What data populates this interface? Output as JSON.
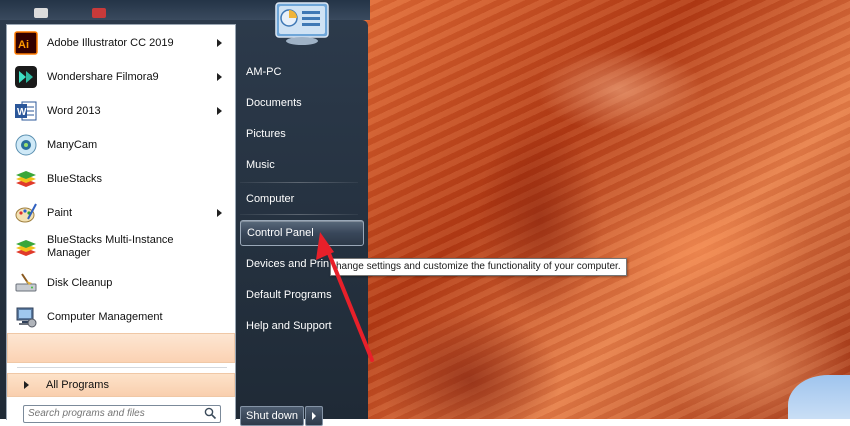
{
  "programs": [
    {
      "label": "Adobe Illustrator CC 2019",
      "icon": "illustrator-icon",
      "has_submenu": true
    },
    {
      "label": "Wondershare Filmora9",
      "icon": "filmora-icon",
      "has_submenu": true
    },
    {
      "label": "Word 2013",
      "icon": "word-icon",
      "has_submenu": true
    },
    {
      "label": "ManyCam",
      "icon": "manycam-icon",
      "has_submenu": false
    },
    {
      "label": "BlueStacks",
      "icon": "bluestacks-icon",
      "has_submenu": false
    },
    {
      "label": "Paint",
      "icon": "paint-icon",
      "has_submenu": true
    },
    {
      "label": "BlueStacks Multi-Instance Manager",
      "label_line1": "BlueStacks Multi-Instance",
      "label_line2": "Manager",
      "icon": "bluestacks-multi-icon",
      "has_submenu": false
    },
    {
      "label": "Disk Cleanup",
      "icon": "disk-cleanup-icon",
      "has_submenu": false
    },
    {
      "label": "Computer Management",
      "icon": "computer-management-icon",
      "has_submenu": false
    }
  ],
  "all_programs": {
    "label": "All Programs"
  },
  "search": {
    "placeholder": "Search programs and files"
  },
  "right_pane": {
    "items": [
      {
        "label": "AM-PC"
      },
      {
        "label": "Documents"
      },
      {
        "label": "Pictures"
      },
      {
        "label": "Music"
      },
      {
        "label": "Computer"
      },
      {
        "label": "Control Panel",
        "selected": true
      },
      {
        "label": "Devices and Printers",
        "visible_label": "Devices and Prin"
      },
      {
        "label": "Default Programs"
      },
      {
        "label": "Help and Support"
      }
    ]
  },
  "shutdown": {
    "label": "Shut down"
  },
  "tooltip": {
    "text": "Change settings and customize the functionality of your computer.",
    "visible_text": "hange settings and customize the functionality of your computer."
  },
  "colors": {
    "menu_bg": "#1f2a36",
    "highlight": "#fbd2b3",
    "annotation_arrow": "#e8202a",
    "wallpaper": "#c8481c"
  },
  "user_picture_icon": "control-panel-icon"
}
